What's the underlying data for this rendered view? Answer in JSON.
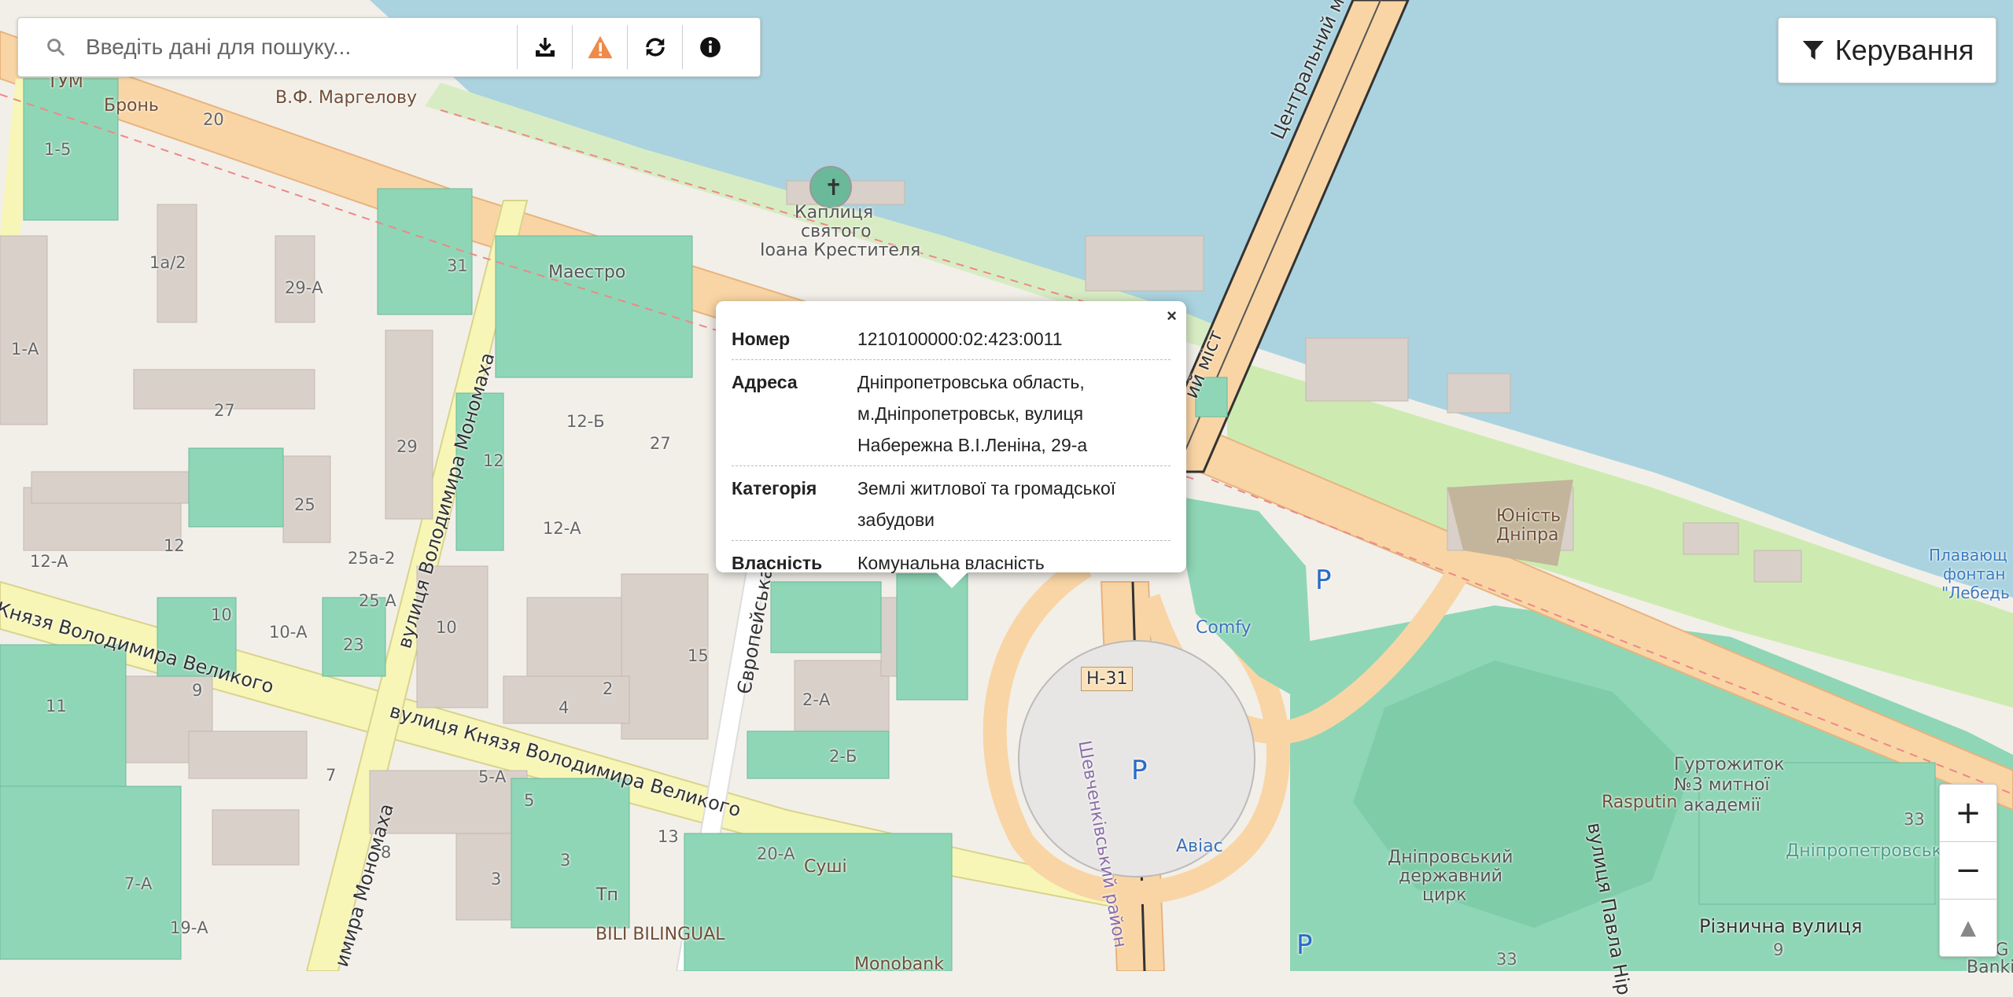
{
  "search": {
    "placeholder": "Введіть дані для пошуку..."
  },
  "toolbar": {
    "download_icon": "download-icon",
    "warning_icon": "warning-icon",
    "refresh_icon": "refresh-icon",
    "info_icon": "info-icon"
  },
  "control": {
    "label": "Керування",
    "icon": "filter-icon"
  },
  "popup": {
    "close": "×",
    "rows": [
      {
        "key": "Номер",
        "value": "1210100000:02:423:0011"
      },
      {
        "key": "Адреса",
        "value": "Дніпропетровська область, м.Дніпропетровськ, вулиця Набережна В.І.Леніна, 29-а"
      },
      {
        "key": "Категорія",
        "value": "Землі житлової та громадської забудови"
      },
      {
        "key": "Власність",
        "value": "Комунальна власність"
      }
    ]
  },
  "zoom": {
    "in": "+",
    "out": "−",
    "compass": "▲"
  },
  "map_labels": {
    "bridge": "Центральний міст",
    "bridge2": "ий міст",
    "chapel1": "Каплиця",
    "chapel2": "святого",
    "chapel3": "Іоана Крестителя",
    "maestro": "Маестро",
    "margelov": "В.Ф. Маргелову",
    "bron": "Бронь",
    "tum": "ТУМ",
    "monomakh": "вулиця Володимира Мономаха",
    "monomakh2": "имира Мономаха",
    "velykoho1": "Князя Володимира Великого",
    "velykoho2": "вулиця Князя Володимира Великого",
    "evropeiska": "Європейська",
    "shevchenka": "Шевченківський район",
    "h31": "Н-31",
    "comfy": "Comfy",
    "avias": "Авіас",
    "yunist1": "Юність",
    "yunist2": "Дніпра",
    "plavuchyi1": "Плавающ",
    "plavuchyi2": "фонтан",
    "plavuchyi3": "\"Лебедь",
    "hurtozhytok1": "Гуртожиток",
    "hurtozhytok2": "№3 митної",
    "hurtozhytok3": "академії",
    "rasputin": "Rasputin",
    "cirk1": "Дніпровський",
    "cirk2": "державний",
    "cirk3": "цирк",
    "dnipropetrovsk": "Дніпропетровськ",
    "riznychna": "Різнична вулиця",
    "pavla": "вулиця Павла Нір",
    "sushi": "Суші",
    "monobank": "Monobank",
    "bili": "BILI BILINGUAL",
    "tagc": "TAG",
    "banking": "Banking",
    "tp": "Тп",
    "p": "P",
    "n20": "20",
    "n1a2": "1а/2",
    "n29a": "29-А",
    "n31": "31",
    "n1a": "1-А",
    "n27": "27",
    "n29": "29",
    "n12": "12",
    "n12b": "12-Б",
    "n27b": "27",
    "n25": "25",
    "n12a": "12-А",
    "n12a2": "12-А",
    "n12c": "12",
    "n25a2": "25а-2",
    "n25a": "25 А",
    "n10": "10",
    "n10a": "10-А",
    "n23": "23",
    "n10b": "10",
    "n15": "15",
    "n2a": "2-А",
    "n2b": "2-Б",
    "n4": "4",
    "n2": "2",
    "n9": "9",
    "n11": "11",
    "n7": "7",
    "n5a": "5-А",
    "n5": "5",
    "n13": "13",
    "n8": "8",
    "n3": "3",
    "n3b": "3",
    "n7a": "7-А",
    "n19a": "19-А",
    "n20a": "20-А",
    "n33": "33",
    "n33b": "33",
    "n9b": "9",
    "n15b": "1-5"
  }
}
